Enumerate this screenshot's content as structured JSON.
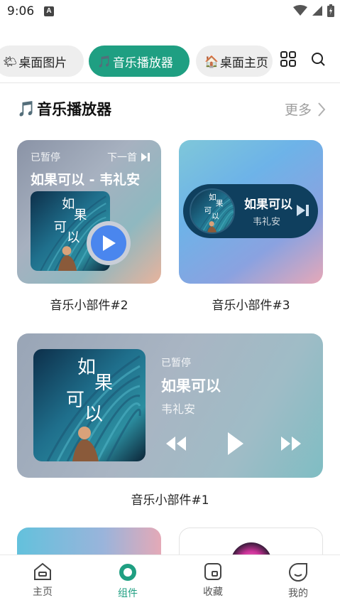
{
  "status_bar": {
    "time": "9:06",
    "notification_badge": "A"
  },
  "tabs": [
    {
      "emoji": "🌤",
      "label": "桌面图片",
      "active": false
    },
    {
      "emoji": "🎵",
      "label": "音乐播放器",
      "active": true
    },
    {
      "emoji": "🏠",
      "label": "桌面主页",
      "active": false
    }
  ],
  "section": {
    "emoji": "🎵",
    "title": "音乐播放器",
    "more": "更多"
  },
  "widgets": {
    "w2": {
      "status": "已暂停",
      "next": "下一首",
      "title": "如果可以 - 韦礼安",
      "label": "音乐小部件#2"
    },
    "w3": {
      "title": "如果可以",
      "artist": "韦礼安",
      "label": "音乐小部件#3"
    },
    "w1": {
      "status": "已暂停",
      "title": "如果可以",
      "artist": "韦礼安",
      "label": "音乐小部件#1"
    }
  },
  "album_art": {
    "title_chars": [
      "如",
      "果",
      "可",
      "以"
    ]
  },
  "bottom_nav": [
    {
      "label": "主页",
      "icon": "home-icon",
      "active": false
    },
    {
      "label": "组件",
      "icon": "widget-icon",
      "active": true
    },
    {
      "label": "收藏",
      "icon": "favorites-icon",
      "active": false
    },
    {
      "label": "我的",
      "icon": "profile-icon",
      "active": false
    }
  ],
  "colors": {
    "accent": "#1f9f82",
    "play_blue": "#4a86ee",
    "pill_dark": "#0f3f5e"
  }
}
